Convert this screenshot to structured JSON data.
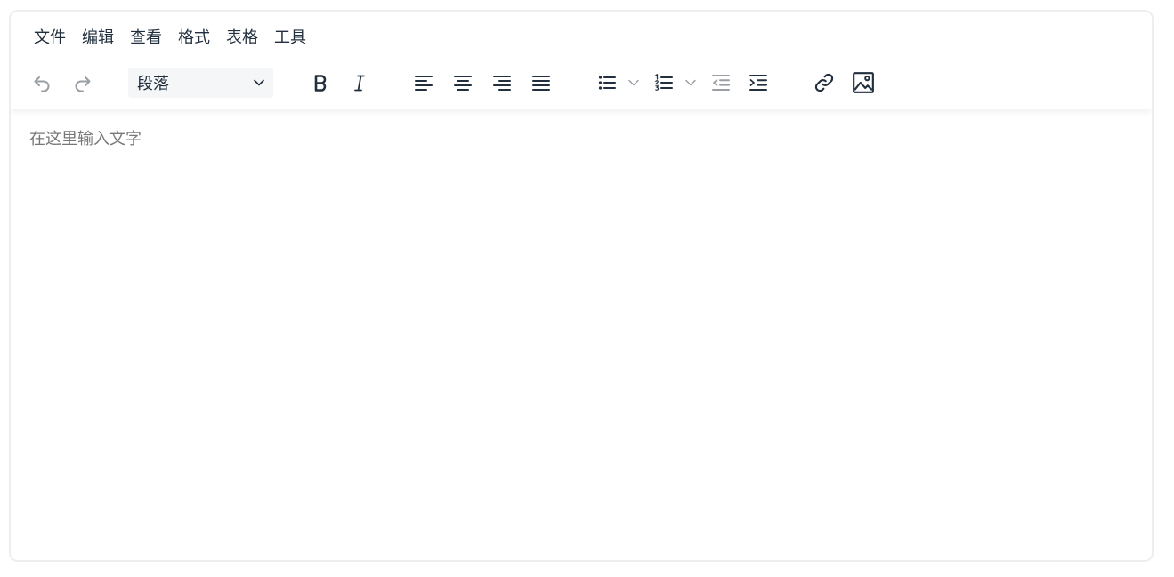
{
  "menubar": {
    "items": [
      {
        "label": "文件"
      },
      {
        "label": "编辑"
      },
      {
        "label": "查看"
      },
      {
        "label": "格式"
      },
      {
        "label": "表格"
      },
      {
        "label": "工具"
      }
    ]
  },
  "toolbar": {
    "block_format": {
      "selected": "段落"
    },
    "buttons": [
      {
        "icon": "undo-icon",
        "state": "disabled"
      },
      {
        "icon": "redo-icon",
        "state": "disabled"
      },
      {
        "icon": "bold-icon"
      },
      {
        "icon": "italic-icon"
      },
      {
        "icon": "align-left-icon"
      },
      {
        "icon": "align-center-icon"
      },
      {
        "icon": "align-right-icon"
      },
      {
        "icon": "align-justify-icon"
      },
      {
        "icon": "bullet-list-icon"
      },
      {
        "icon": "numbered-list-icon"
      },
      {
        "icon": "outdent-icon",
        "state": "disabled"
      },
      {
        "icon": "indent-icon"
      },
      {
        "icon": "link-icon"
      },
      {
        "icon": "image-icon"
      }
    ]
  },
  "content": {
    "placeholder": "在这里输入文字"
  },
  "colors": {
    "icon": "#222f3e",
    "icon_disabled": "#9a9fa5",
    "placeholder": "#777777",
    "select_bg": "#f5f6f7"
  }
}
